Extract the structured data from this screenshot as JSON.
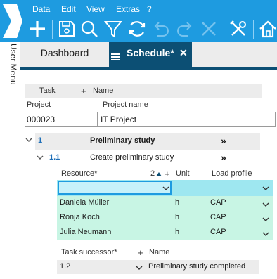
{
  "menu": [
    "Data",
    "Edit",
    "View",
    "Extras",
    "?"
  ],
  "user_menu": "User Menu",
  "tabs": {
    "dashboard": "Dashboard",
    "schedule": "Schedule*",
    "close": "✕"
  },
  "task_header": {
    "task": "Task",
    "plus": "+",
    "name": "Name"
  },
  "project": {
    "label_id": "Project",
    "label_name": "Project name",
    "id": "000023",
    "name": "IT Project"
  },
  "tasks": [
    {
      "number": "1",
      "name": "Preliminary study",
      "more": "»"
    },
    {
      "number": "1.1",
      "name": "Create preliminary study",
      "more": "»"
    }
  ],
  "resources": {
    "h_resource": "Resource*",
    "h_sort": "2",
    "h_plus": "+",
    "h_unit": "Unit",
    "h_load": "Load profile",
    "rows": [
      {
        "name": "Daniela Müller",
        "unit": "h",
        "load": "CAP"
      },
      {
        "name": "Ronja Koch",
        "unit": "h",
        "load": "CAP"
      },
      {
        "name": "Julia Neumann",
        "unit": "h",
        "load": "CAP"
      }
    ]
  },
  "successor": {
    "h_label": "Task successor*",
    "h_plus": "+",
    "h_name": "Name",
    "value": "1.2",
    "name": "Preliminary study completed"
  },
  "colors": {
    "accent": "#1e9be0",
    "tab_active": "#0c4f74",
    "mint": "#c8f5e4",
    "cyan": "#9ee7f0"
  }
}
